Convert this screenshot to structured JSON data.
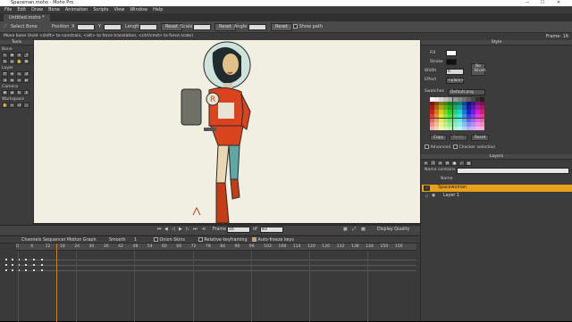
{
  "titlebar": {
    "title": "Spaceman.moho - Moho Pro",
    "min": "—",
    "max": "☐",
    "close": "✕"
  },
  "menu": [
    "File",
    "Edit",
    "Draw",
    "Bone",
    "Animation",
    "Scripts",
    "View",
    "Window",
    "Help"
  ],
  "doc_tab": "Untitled.moho *",
  "tool_options": {
    "tool": "Select Bone",
    "position_label": "Position",
    "x_label": "X",
    "y_label": "Y",
    "length_label": "Length",
    "reset": "Reset",
    "scale_label": "Scale",
    "angle_label": "Angle",
    "show_path": "Show path"
  },
  "hint": "Move bone (hold <shift> to constrain, <alt> to force translation, <ctrl/cmd> to force scale)",
  "frame_indicator": "Frame: 16",
  "tools_panel": {
    "title": "Tools",
    "groups": [
      "Bone",
      "Layer",
      "Camera",
      "Workspace"
    ]
  },
  "style_panel": {
    "title": "Style",
    "fill": "Fill",
    "stroke": "Stroke",
    "width_label": "Width",
    "width_value": "6",
    "effect_label": "Effect",
    "effect_value": "<plain>",
    "no_brush": "No Brush",
    "swatches_label": "Swatches",
    "swatches_value": "Default.png",
    "copy": "Copy",
    "paste": "Paste",
    "reset": "Reset",
    "advanced": "Advanced",
    "checker": "Checker selection"
  },
  "layers_panel": {
    "title": "Layers",
    "search_placeholder": "Name contains",
    "name_col": "Name",
    "items": [
      {
        "name": "Spacewoman",
        "selected": true
      },
      {
        "name": "Layer 1",
        "selected": false
      }
    ]
  },
  "playback": {
    "frame_label": "Frame",
    "frame_value": "16",
    "of_label": "of",
    "total": "83",
    "display_quality": "Display Quality"
  },
  "timeline_tabs": {
    "channels": "Channels",
    "sequencer": "Sequencer",
    "motion_graph": "Motion Graph",
    "smooth": "Smooth",
    "smooth_val": "1",
    "onion_skins": "Onion Skins",
    "relative_keyframing": "Relative keyframing",
    "auto_freeze": "Auto-freeze keys"
  },
  "ruler_ticks": [
    "0",
    "6",
    "12",
    "18",
    "24",
    "30",
    "36",
    "42",
    "48",
    "54",
    "60",
    "66",
    "72",
    "78",
    "84",
    "90",
    "96",
    "102",
    "108",
    "114",
    "120",
    "126",
    "132",
    "138",
    "144",
    "150",
    "156"
  ],
  "colors": {
    "accent": "#e8a21a",
    "canvas": "#f1efe2",
    "panel": "#3c3c3c"
  }
}
